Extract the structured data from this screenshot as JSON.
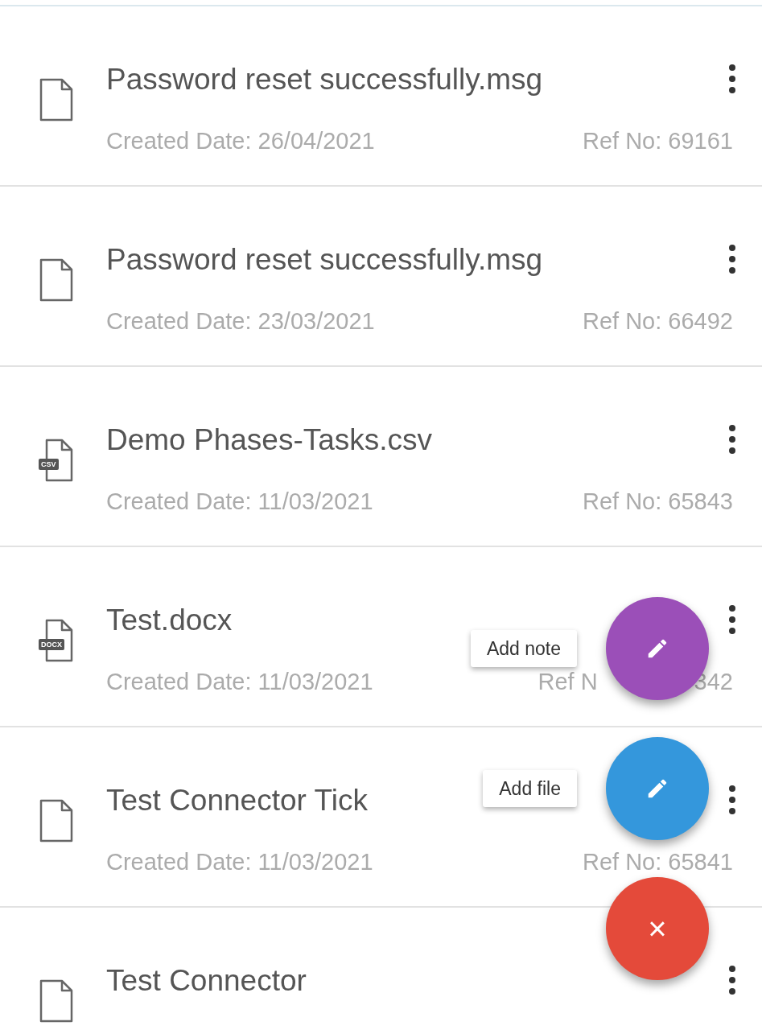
{
  "files": [
    {
      "kind": "file",
      "name": "Password reset successfully.msg",
      "created": "Created Date: 26/04/2021",
      "ref": [
        "Ref No: 69161"
      ]
    },
    {
      "kind": "file",
      "name": "Password reset successfully.msg",
      "created": "Created Date: 23/03/2021",
      "ref": [
        "Ref No: 66492"
      ]
    },
    {
      "kind": "badged",
      "badge": "CSV",
      "name": "Demo Phases-Tasks.csv",
      "created": "Created Date: 11/03/2021",
      "ref": [
        "Ref No: 65843"
      ]
    },
    {
      "kind": "badged",
      "badge": "DOCX",
      "name": "Test.docx",
      "created": "Created Date: 11/03/2021",
      "ref": [
        "Ref N",
        "342"
      ]
    },
    {
      "kind": "file",
      "name": "Test Connector Tick",
      "created": "Created Date: 11/03/2021",
      "ref": [
        "Ref No: 65841"
      ]
    },
    {
      "kind": "file",
      "name": "Test Connector"
    }
  ],
  "fab_actions": [
    {
      "kind": "note",
      "tooltip": "Add note"
    },
    {
      "kind": "file",
      "tooltip": "Add file"
    }
  ],
  "fab_close": {
    "label": "×"
  }
}
